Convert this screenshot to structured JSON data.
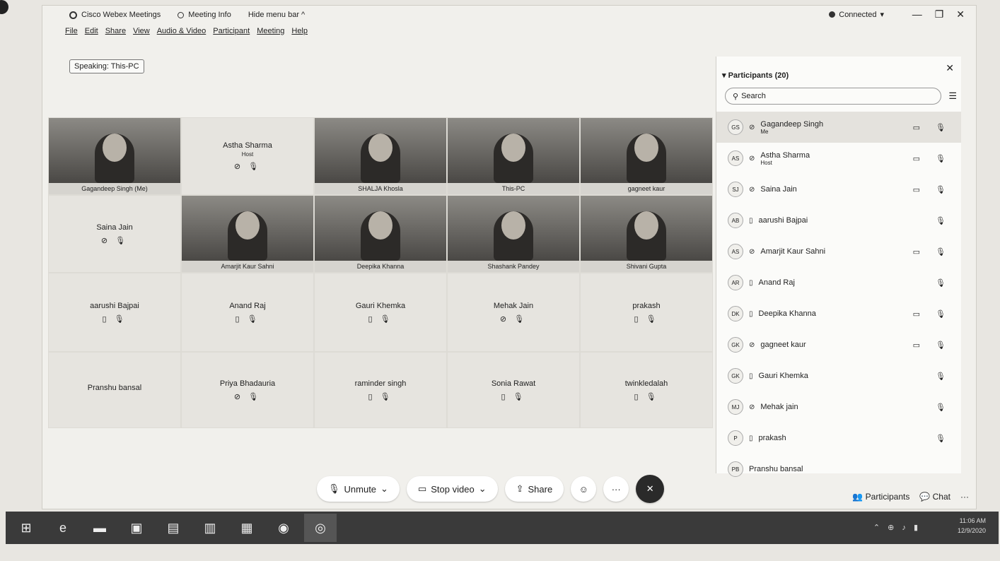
{
  "titlebar": {
    "app": "Cisco Webex Meetings",
    "meeting_info": "Meeting Info",
    "hide_menu": "Hide menu bar ^",
    "connected": "Connected",
    "connected_caret": "▾",
    "minimize": "—",
    "restore": "❐",
    "close": "✕"
  },
  "menu": [
    "File",
    "Edit",
    "Share",
    "View",
    "Audio & Video",
    "Participant",
    "Meeting",
    "Help"
  ],
  "speaking": "Speaking: This-PC",
  "tiles": [
    {
      "name": "Gagandeep Singh (Me)",
      "video": true
    },
    {
      "name": "Astha Sharma",
      "sub": "Host",
      "icons": "⊘ 🎙",
      "video": false
    },
    {
      "name": "SHALJA Khosla",
      "video": true
    },
    {
      "name": "This-PC",
      "video": true
    },
    {
      "name": "gagneet kaur",
      "video": true
    },
    {
      "name": "Saina Jain",
      "icons": "⊘ 🎙",
      "video": false
    },
    {
      "name": "Amarjit Kaur Sahni",
      "video": true
    },
    {
      "name": "Deepika Khanna",
      "video": true
    },
    {
      "name": "Shashank Pandey",
      "video": true
    },
    {
      "name": "Shivani Gupta",
      "video": true
    },
    {
      "name": "aarushi Bajpai",
      "icons": "▯ 🎙",
      "video": false
    },
    {
      "name": "Anand Raj",
      "icons": "▯ 🎙",
      "video": false
    },
    {
      "name": "Gauri Khemka",
      "icons": "▯ 🎙",
      "video": false
    },
    {
      "name": "Mehak Jain",
      "icons": "⊘ 🎙",
      "video": false
    },
    {
      "name": "prakash",
      "icons": "▯ 🎙",
      "video": false
    },
    {
      "name": "Pranshu bansal",
      "icons": "",
      "video": false
    },
    {
      "name": "Priya Bhadauria",
      "icons": "⊘ 🎙",
      "video": false
    },
    {
      "name": "raminder singh",
      "icons": "▯ 🎙",
      "video": false
    },
    {
      "name": "Sonia Rawat",
      "icons": "▯ 🎙",
      "video": false
    },
    {
      "name": "twinkledalah",
      "icons": "▯ 🎙",
      "video": false
    }
  ],
  "panel": {
    "header": "Participants (20)",
    "search_placeholder": "Search",
    "participants": [
      {
        "initials": "GS",
        "name": "Gagandeep Singh",
        "role": "Me",
        "status": "⊘",
        "cam": "▭",
        "mic": "🎙"
      },
      {
        "initials": "AS",
        "name": "Astha Sharma",
        "role": "Host",
        "status": "⊘",
        "cam": "▭",
        "mic": "🎙"
      },
      {
        "initials": "SJ",
        "name": "Saina Jain",
        "role": "",
        "status": "⊘",
        "cam": "▭",
        "mic": "🎙"
      },
      {
        "initials": "AB",
        "name": "aarushi Bajpai",
        "role": "",
        "status": "▯",
        "cam": "",
        "mic": "🎙"
      },
      {
        "initials": "AS",
        "name": "Amarjit Kaur Sahni",
        "role": "",
        "status": "⊘",
        "cam": "▭",
        "mic": "🎙"
      },
      {
        "initials": "AR",
        "name": "Anand Raj",
        "role": "",
        "status": "▯",
        "cam": "",
        "mic": "🎙"
      },
      {
        "initials": "DK",
        "name": "Deepika Khanna",
        "role": "",
        "status": "▯",
        "cam": "▭",
        "mic": "🎙"
      },
      {
        "initials": "GK",
        "name": "gagneet kaur",
        "role": "",
        "status": "⊘",
        "cam": "▭",
        "mic": "🎙"
      },
      {
        "initials": "GK",
        "name": "Gauri Khemka",
        "role": "",
        "status": "▯",
        "cam": "",
        "mic": "🎙"
      },
      {
        "initials": "MJ",
        "name": "Mehak jain",
        "role": "",
        "status": "⊘",
        "cam": "",
        "mic": "🎙"
      },
      {
        "initials": "P",
        "name": "prakash",
        "role": "",
        "status": "▯",
        "cam": "",
        "mic": "🎙"
      },
      {
        "initials": "PB",
        "name": "Pranshu bansal",
        "role": "",
        "status": "",
        "cam": "",
        "mic": ""
      }
    ]
  },
  "toolbar": {
    "unmute": "Unmute",
    "stop_video": "Stop video",
    "share": "Share",
    "caret": "⌄",
    "emoji": "☺",
    "more": "···",
    "end": "✕"
  },
  "bottom_right": {
    "participants": "Participants",
    "chat": "Chat",
    "more": "···"
  },
  "tray": {
    "time": "11:06 AM",
    "date": "12/9/2020"
  }
}
